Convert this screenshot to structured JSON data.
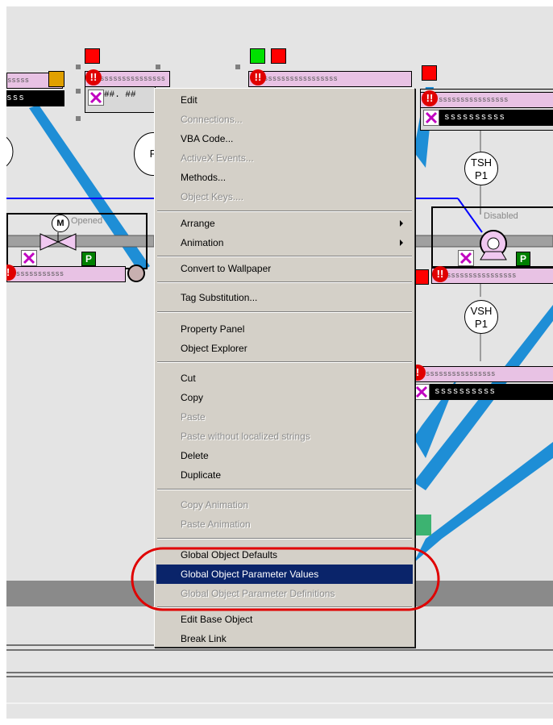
{
  "colors": {
    "canvas_bg": "#e4e4e4",
    "menu_bg": "#d4d0c8",
    "menu_selected": "#0a246a",
    "annotation_red": "#e00000",
    "pipe_blue": "#1e8ed6",
    "faceplate_pink": "#e8c2e4"
  },
  "faceplates": {
    "top_left_strip": "sssss",
    "top_left_display": "sss",
    "top_center_strip": "sssssssssssssss",
    "top_center_display": "##. ##",
    "top_mid_strip": "sssssssssssssssss",
    "top_right_strip": "ssssssssssssssss",
    "top_right_display": "ssssssssss",
    "valve_strip": "sssssssssssss",
    "pump_strip": "ssssssssssssssss",
    "lower_right_strip": "ssssssssssssssss",
    "lower_right_display": "ssssssssss",
    "partial_tag": "P"
  },
  "valve": {
    "motor_label": "M",
    "status": "Opened",
    "p_badge": "P"
  },
  "pump": {
    "status": "Disabled",
    "p_badge": "P"
  },
  "tags": {
    "tsh_line1": "TSH",
    "tsh_line2": "P1",
    "vsh_line1": "VSH",
    "vsh_line2": "P1"
  },
  "context_menu": {
    "edit": "Edit",
    "connections": "Connections...",
    "vba_code": "VBA Code...",
    "activex_events": "ActiveX Events...",
    "methods": "Methods...",
    "object_keys": "Object Keys....",
    "arrange": "Arrange",
    "animation": "Animation",
    "convert_wallpaper": "Convert to Wallpaper",
    "tag_substitution": "Tag Substitution...",
    "property_panel": "Property Panel",
    "object_explorer": "Object Explorer",
    "cut": "Cut",
    "copy": "Copy",
    "paste": "Paste",
    "paste_without": "Paste without localized strings",
    "delete": "Delete",
    "duplicate": "Duplicate",
    "copy_animation": "Copy Animation",
    "paste_animation": "Paste Animation",
    "global_defaults": "Global Object Defaults",
    "global_param_values": "Global Object Parameter Values",
    "global_param_definitions": "Global Object Parameter Definitions",
    "edit_base_object": "Edit Base Object",
    "break_link": "Break Link"
  }
}
